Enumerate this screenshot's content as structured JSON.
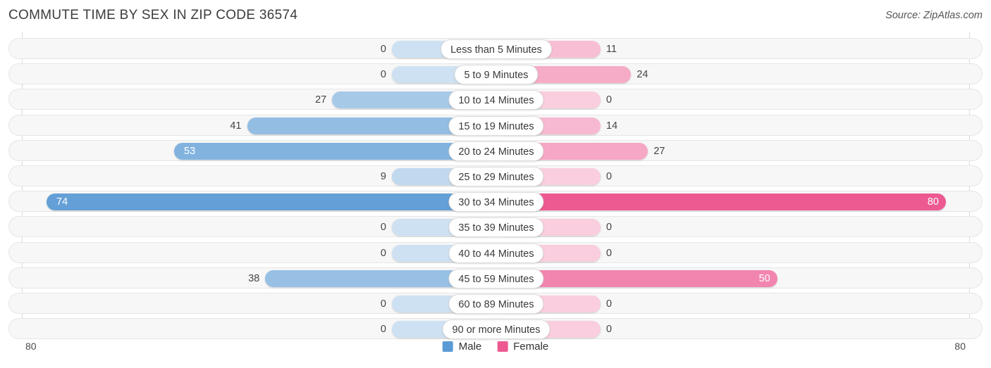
{
  "header": {
    "title": "COMMUTE TIME BY SEX IN ZIP CODE 36574",
    "source": "Source: ZipAtlas.com"
  },
  "axis": {
    "left_tick": "80",
    "right_tick": "80",
    "max": 80
  },
  "legend": {
    "items": [
      {
        "label": "Male",
        "color": "#5b9bd5"
      },
      {
        "label": "Female",
        "color": "#ed5a92"
      }
    ]
  },
  "colors": {
    "male": "#5b9bd5",
    "female": "#ed5a92",
    "track": "#f7f7f7",
    "track_border": "#e6e6e6",
    "pill_bg": "#ffffff"
  },
  "chart_data": {
    "type": "bar",
    "orientation": "horizontal-diverging",
    "title": "COMMUTE TIME BY SEX IN ZIP CODE 36574",
    "xlabel": "",
    "ylabel": "",
    "xlim": [
      -80,
      80
    ],
    "axis_ticks": [
      "80",
      "80"
    ],
    "legend_position": "bottom-center",
    "grid": false,
    "categories": [
      "Less than 5 Minutes",
      "5 to 9 Minutes",
      "10 to 14 Minutes",
      "15 to 19 Minutes",
      "20 to 24 Minutes",
      "25 to 29 Minutes",
      "30 to 34 Minutes",
      "35 to 39 Minutes",
      "40 to 44 Minutes",
      "45 to 59 Minutes",
      "60 to 89 Minutes",
      "90 or more Minutes"
    ],
    "series": [
      {
        "name": "Male",
        "values": [
          0,
          0,
          27,
          41,
          53,
          9,
          74,
          0,
          0,
          38,
          0,
          0
        ]
      },
      {
        "name": "Female",
        "values": [
          11,
          24,
          0,
          14,
          27,
          0,
          80,
          0,
          0,
          50,
          0,
          0
        ]
      }
    ]
  },
  "rows": [
    {
      "label": "Less than 5 Minutes",
      "male": "0",
      "female": "11",
      "male_val": 0,
      "female_val": 11
    },
    {
      "label": "5 to 9 Minutes",
      "male": "0",
      "female": "24",
      "male_val": 0,
      "female_val": 24
    },
    {
      "label": "10 to 14 Minutes",
      "male": "27",
      "female": "0",
      "male_val": 27,
      "female_val": 0
    },
    {
      "label": "15 to 19 Minutes",
      "male": "41",
      "female": "14",
      "male_val": 41,
      "female_val": 14
    },
    {
      "label": "20 to 24 Minutes",
      "male": "53",
      "female": "27",
      "male_val": 53,
      "female_val": 27
    },
    {
      "label": "25 to 29 Minutes",
      "male": "9",
      "female": "0",
      "male_val": 9,
      "female_val": 0
    },
    {
      "label": "30 to 34 Minutes",
      "male": "74",
      "female": "80",
      "male_val": 74,
      "female_val": 80
    },
    {
      "label": "35 to 39 Minutes",
      "male": "0",
      "female": "0",
      "male_val": 0,
      "female_val": 0
    },
    {
      "label": "40 to 44 Minutes",
      "male": "0",
      "female": "0",
      "male_val": 0,
      "female_val": 0
    },
    {
      "label": "45 to 59 Minutes",
      "male": "38",
      "female": "50",
      "male_val": 38,
      "female_val": 50
    },
    {
      "label": "60 to 89 Minutes",
      "male": "0",
      "female": "0",
      "male_val": 0,
      "female_val": 0
    },
    {
      "label": "90 or more Minutes",
      "male": "0",
      "female": "0",
      "male_val": 0,
      "female_val": 0
    }
  ]
}
